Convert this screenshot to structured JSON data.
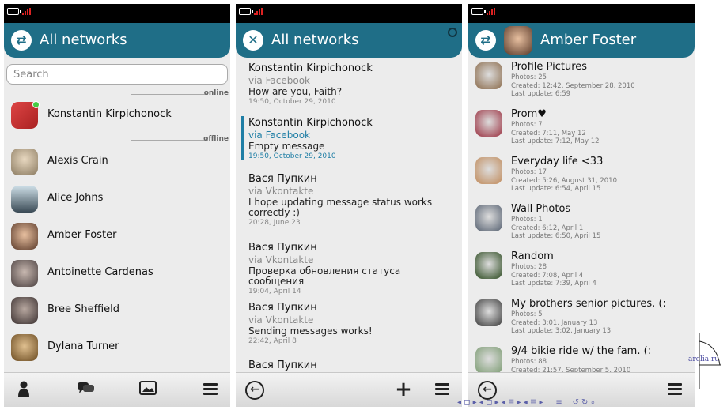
{
  "screen1": {
    "title": "All networks",
    "search_placeholder": "Search",
    "online_label": "online",
    "offline_label": "offline",
    "online_contacts": [
      {
        "name": "Konstantin Kirpichonock"
      }
    ],
    "offline_contacts": [
      {
        "name": "Alexis Crain"
      },
      {
        "name": "Alice Johns"
      },
      {
        "name": "Amber Foster"
      },
      {
        "name": "Antoinette Cardenas"
      },
      {
        "name": "Bree Sheffield"
      },
      {
        "name": "Dylana Turner"
      }
    ],
    "toolbar": [
      "person-icon",
      "chat-bubbles-icon",
      "picture-icon",
      "menu-icon"
    ]
  },
  "screen2": {
    "title": "All networks",
    "messages": [
      {
        "name": "Konstantin Kirpichonock",
        "via": "via Facebook",
        "text": "How are you, Faith?",
        "time": "19:50, October 29, 2010"
      },
      {
        "name": "Konstantin Kirpichonock",
        "via": "via Facebook",
        "text": "Empty message",
        "time": "19:50, October 29, 2010",
        "selected": true
      },
      {
        "name": "Вася Пупкин",
        "via": "via Vkontakte",
        "text": "I hope updating message status works correctly :)",
        "time": "20:28, June 23"
      },
      {
        "name": "Вася Пупкин",
        "via": "via Vkontakte",
        "text": "Проверка обновления статуса сообщения",
        "time": "19:04, April 14"
      },
      {
        "name": "Вася Пупкин",
        "via": "via Vkontakte",
        "text": "Sending messages works!",
        "time": "22:42, April 8"
      },
      {
        "name": "Вася Пупкин",
        "via": "",
        "text": "",
        "time": ""
      }
    ],
    "toolbar": [
      "back-arrow-icon",
      "plus-icon",
      "menu-icon"
    ]
  },
  "screen3": {
    "title": "Amber Foster",
    "albums": [
      {
        "title": "Profile Pictures",
        "photos": "Photos: 25",
        "created": "Created: 12:42, September 28, 2010",
        "updated": "Last update: 6:59",
        "color": "#8a6a4a"
      },
      {
        "title": "Prom♥",
        "photos": "Photos: 7",
        "created": "Created: 7:11, May 12",
        "updated": "Last update: 7:12, May 12",
        "color": "#9a3040"
      },
      {
        "title": "Everyday life  <33",
        "photos": "Photos: 17",
        "created": "Created: 5:26, August 31, 2010",
        "updated": "Last update: 6:54, April 15",
        "color": "#c08a5a"
      },
      {
        "title": "Wall Photos",
        "photos": "Photos: 1",
        "created": "Created: 6:12, April 1",
        "updated": "Last update: 6:50, April 15",
        "color": "#556070"
      },
      {
        "title": "Random",
        "photos": "Photos: 28",
        "created": "Created: 7:08, April 4",
        "updated": "Last update: 7:39, April 4",
        "color": "#2c4a20"
      },
      {
        "title": "My brothers senior pictures. (:",
        "photos": "Photos: 5",
        "created": "Created: 3:01, January 13",
        "updated": "Last update: 3:02, January 13",
        "color": "#3a3a3a"
      },
      {
        "title": "9/4 bikie ride w/ the fam. (:",
        "photos": "Photos: 88",
        "created": "Created: 21:57, September 5, 2010",
        "updated": "",
        "color": "#7a9a70"
      }
    ],
    "toolbar": [
      "back-arrow-icon",
      "menu-icon"
    ]
  },
  "side_logo_text": "arelia.ru",
  "colors": {
    "titlebar": "#1f6e87",
    "accent": "#1f7ea5",
    "background": "#ececec"
  }
}
